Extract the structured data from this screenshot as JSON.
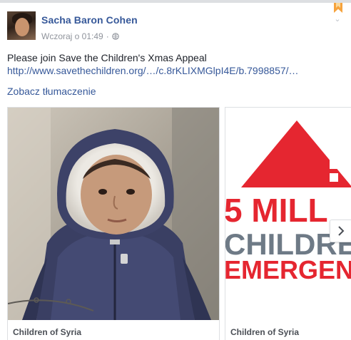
{
  "post": {
    "author": "Sacha Baron Cohen",
    "timestamp": "Wczoraj o 01:49",
    "separator": "·",
    "privacy_icon": "globe-icon",
    "message": "Please join Save the Children's Xmas Appeal",
    "link": "http://www.savethechildren.org/…/c.8rKLIXMGlpI4E/b.7998857/…",
    "translate_label": "Zobacz tłumaczenie"
  },
  "carousel": {
    "cards": [
      {
        "caption": "Children of Syria",
        "image": "child-in-hooded-jacket-photo"
      },
      {
        "caption": "Children of Syria",
        "image": "emergency-warning-graphic",
        "graphic_lines": [
          "5 MILL",
          "CHILDRE",
          "EMERGENC"
        ]
      }
    ],
    "next_icon": "chevron-right-icon"
  },
  "colors": {
    "link_blue": "#365899",
    "meta_gray": "#90949c",
    "alert_red": "#e52630",
    "graphic_gray": "#6e7a86",
    "bookmark_orange": "#f6a33d"
  }
}
